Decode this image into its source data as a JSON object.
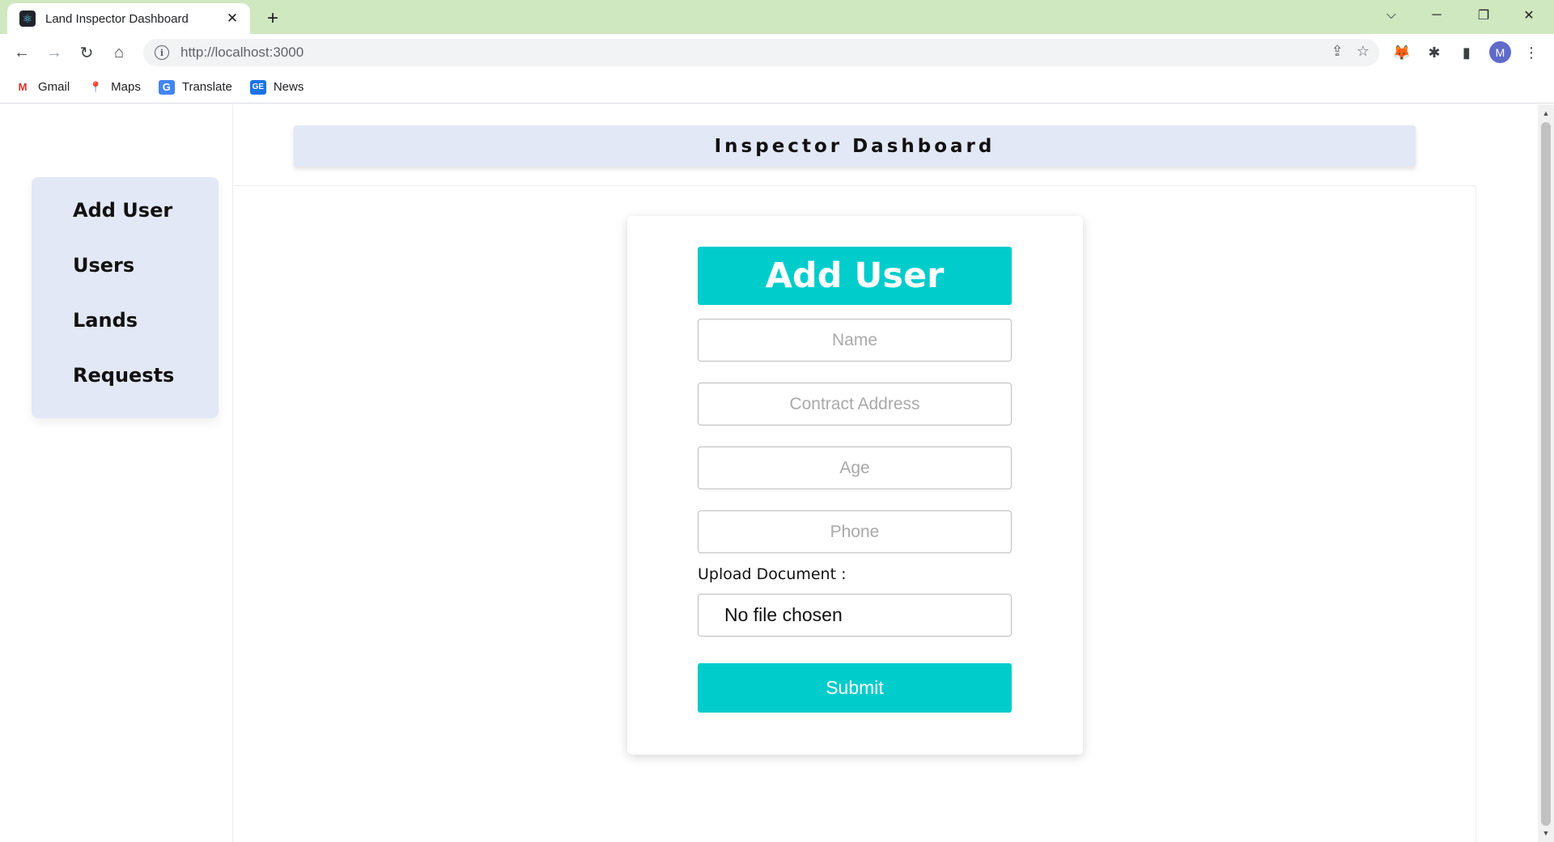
{
  "browser": {
    "tab_title": "Land Inspector Dashboard",
    "url": "http://localhost:3000",
    "profile_initial": "M",
    "bookmarks": [
      {
        "label": "Gmail",
        "icon": "gmail-icon"
      },
      {
        "label": "Maps",
        "icon": "maps-icon"
      },
      {
        "label": "Translate",
        "icon": "translate-icon"
      },
      {
        "label": "News",
        "icon": "news-icon"
      }
    ]
  },
  "header": {
    "title": "Inspector Dashboard"
  },
  "sidebar": {
    "items": [
      {
        "label": "Add User"
      },
      {
        "label": "Users"
      },
      {
        "label": "Lands"
      },
      {
        "label": "Requests"
      }
    ]
  },
  "form": {
    "title": "Add User",
    "name_placeholder": "Name",
    "address_placeholder": "Contract Address",
    "age_placeholder": "Age",
    "phone_placeholder": "Phone",
    "upload_label": "Upload Document :",
    "file_status": "No file chosen",
    "submit_label": "Submit"
  },
  "colors": {
    "accent": "#00cccc",
    "panel": "#e3e8f6",
    "tabstrip": "#cfe8c0"
  }
}
